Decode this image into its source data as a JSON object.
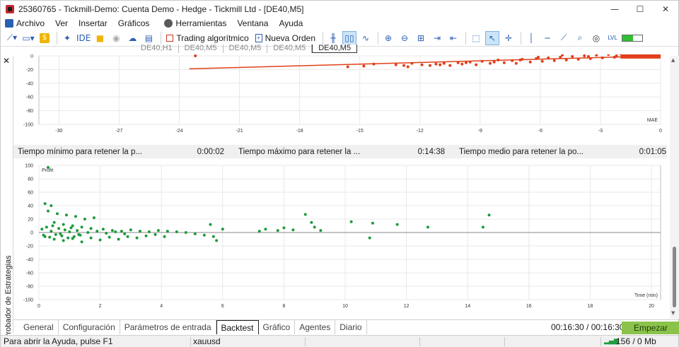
{
  "window": {
    "title": "25360765 - Tickmill-Demo: Cuenta Demo - Hedge - Tickmill Ltd - [DE40,M5]",
    "minimize": "—",
    "maximize": "☐",
    "close": "✕"
  },
  "menu": [
    "Archivo",
    "Ver",
    "Insertar",
    "Gráficos",
    "Herramientas",
    "Ventana",
    "Ayuda"
  ],
  "toolbar": {
    "ide_label": "IDE",
    "algo_label": "Trading algorítmico",
    "order_label": "Nueva Orden",
    "battery_label": "LVL",
    "battery_level": 0.55
  },
  "chart_tabs": [
    "DE40,H1",
    "DE40,M5",
    "DE40,M5",
    "DE40,M5",
    "DE40,M5"
  ],
  "mae_chart": {
    "type": "scatter",
    "xlabel": "MAE",
    "xlim": [
      -31,
      0
    ],
    "ylim": [
      -100,
      0
    ],
    "xticks": [
      -30,
      -27,
      -24,
      -21,
      -18,
      -15,
      -12,
      -9,
      -6,
      -3,
      0
    ],
    "yticks": [
      0,
      -20,
      -40,
      -60,
      -80,
      -100
    ],
    "color": "#e0401a",
    "trend": [
      [
        -23.5,
        -19
      ],
      [
        0,
        0
      ]
    ],
    "points": [
      [
        -23.2,
        0
      ],
      [
        -15.3,
        4
      ],
      [
        -15.6,
        -16
      ],
      [
        -14.8,
        -15
      ],
      [
        -14.3,
        -12
      ],
      [
        -13.2,
        -13
      ],
      [
        -12.8,
        -14
      ],
      [
        -12.4,
        -11
      ],
      [
        -12.6,
        -16
      ],
      [
        -11.9,
        -13
      ],
      [
        -11.5,
        -14
      ],
      [
        -11.2,
        -12
      ],
      [
        -10.8,
        -11
      ],
      [
        -10.5,
        -14
      ],
      [
        -10.1,
        -10
      ],
      [
        -9.9,
        -12
      ],
      [
        -9.5,
        -9
      ],
      [
        -9.2,
        -13
      ],
      [
        -8.9,
        -8
      ],
      [
        -8.5,
        -11
      ],
      [
        -8.1,
        -6
      ],
      [
        -7.8,
        -10
      ],
      [
        -7.4,
        -7
      ],
      [
        -7.2,
        -11
      ],
      [
        -6.9,
        -5
      ],
      [
        -6.5,
        -9
      ],
      [
        -6.2,
        -4
      ],
      [
        -5.9,
        -8
      ],
      [
        -5.6,
        -3
      ],
      [
        -5.3,
        -7
      ],
      [
        -5.0,
        -2
      ],
      [
        -4.7,
        -6
      ],
      [
        -4.4,
        -1
      ],
      [
        -4.1,
        -5
      ],
      [
        -3.8,
        0
      ],
      [
        -3.5,
        -4
      ],
      [
        -3.2,
        1
      ],
      [
        -2.9,
        -3
      ],
      [
        -2.6,
        2
      ],
      [
        -2.3,
        -2
      ],
      [
        -2.0,
        3
      ],
      [
        -1.7,
        -1
      ],
      [
        -1.4,
        4
      ],
      [
        -1.1,
        0
      ],
      [
        -0.8,
        5
      ],
      [
        -0.5,
        1
      ],
      [
        -0.2,
        6
      ],
      [
        -6.1,
        -2
      ],
      [
        -4.9,
        1
      ],
      [
        -3.6,
        -1
      ],
      [
        -2.2,
        0
      ],
      [
        -1.2,
        2
      ],
      [
        -0.6,
        3
      ],
      [
        -7.0,
        -6
      ],
      [
        -8.3,
        -9
      ],
      [
        -9.7,
        -10
      ],
      [
        -11.0,
        -13
      ]
    ],
    "dense_band": [
      -2.0,
      0
    ]
  },
  "stats": {
    "min_label": "Tiempo mínimo para retener la p...",
    "min_value": "0:00:02",
    "max_label": "Tiempo máximo para retener la ...",
    "max_value": "0:14:38",
    "avg_label": "Tiempo medio para retener la po...",
    "avg_value": "0:01:05"
  },
  "profit_chart": {
    "type": "scatter",
    "label": "Profit",
    "xlabel": "Time (min)",
    "xlim": [
      0,
      20.3
    ],
    "ylim": [
      -100,
      100
    ],
    "xticks": [
      0,
      2,
      4,
      6,
      8,
      10,
      12,
      14,
      16,
      18,
      20
    ],
    "yticks": [
      100,
      80,
      60,
      40,
      20,
      0,
      -20,
      -40,
      -60,
      -80,
      -100
    ],
    "color": "#1e9b3b",
    "points": [
      [
        0.3,
        97
      ],
      [
        0.2,
        43
      ],
      [
        0.4,
        40
      ],
      [
        0.3,
        32
      ],
      [
        0.6,
        28
      ],
      [
        0.9,
        26
      ],
      [
        1.2,
        24
      ],
      [
        1.5,
        20
      ],
      [
        1.8,
        22
      ],
      [
        0.5,
        15
      ],
      [
        0.8,
        12
      ],
      [
        1.1,
        10
      ],
      [
        1.4,
        8
      ],
      [
        1.7,
        6
      ],
      [
        2.1,
        5
      ],
      [
        2.4,
        3
      ],
      [
        2.7,
        2
      ],
      [
        3.0,
        4
      ],
      [
        3.3,
        2
      ],
      [
        3.6,
        1
      ],
      [
        3.9,
        3
      ],
      [
        4.2,
        2
      ],
      [
        4.5,
        1
      ],
      [
        4.8,
        0
      ],
      [
        5.1,
        -2
      ],
      [
        5.4,
        -4
      ],
      [
        5.7,
        -6
      ],
      [
        6.0,
        5
      ],
      [
        5.8,
        -12
      ],
      [
        5.6,
        12
      ],
      [
        7.2,
        2
      ],
      [
        7.4,
        5
      ],
      [
        7.8,
        3
      ],
      [
        8.0,
        7
      ],
      [
        8.3,
        4
      ],
      [
        8.7,
        27
      ],
      [
        8.9,
        15
      ],
      [
        9.0,
        8
      ],
      [
        9.2,
        3
      ],
      [
        10.2,
        16
      ],
      [
        10.8,
        -8
      ],
      [
        10.9,
        14
      ],
      [
        11.7,
        12
      ],
      [
        12.7,
        8
      ],
      [
        14.5,
        8
      ],
      [
        14.7,
        26
      ],
      [
        0.2,
        -6
      ],
      [
        0.5,
        -10
      ],
      [
        0.8,
        -12
      ],
      [
        1.1,
        -9
      ],
      [
        1.4,
        -14
      ],
      [
        1.7,
        -8
      ],
      [
        2.0,
        -11
      ],
      [
        2.3,
        -7
      ],
      [
        2.6,
        -10
      ],
      [
        2.9,
        -6
      ],
      [
        3.2,
        -8
      ],
      [
        3.5,
        -5
      ],
      [
        3.8,
        -3
      ],
      [
        4.1,
        -6
      ],
      [
        0.4,
        2
      ],
      [
        0.7,
        -2
      ],
      [
        1.0,
        1
      ],
      [
        1.3,
        -3
      ],
      [
        1.6,
        0
      ],
      [
        1.9,
        2
      ],
      [
        2.2,
        -1
      ],
      [
        2.5,
        1
      ],
      [
        2.8,
        -2
      ],
      [
        0.1,
        5
      ],
      [
        0.15,
        -4
      ],
      [
        0.25,
        8
      ],
      [
        0.35,
        -7
      ],
      [
        0.45,
        10
      ],
      [
        0.55,
        -3
      ],
      [
        0.65,
        6
      ],
      [
        0.75,
        -5
      ],
      [
        0.85,
        4
      ],
      [
        0.95,
        -8
      ],
      [
        1.05,
        7
      ],
      [
        1.15,
        -6
      ],
      [
        1.25,
        3
      ],
      [
        1.35,
        -4
      ]
    ]
  },
  "side_panel_label": "Probador de Estrategias",
  "bottom_tabs": [
    "General",
    "Configuración",
    "Parámetros de entrada",
    "Backtest",
    "Gráfico",
    "Agentes",
    "Diario"
  ],
  "active_tab": "Backtest",
  "test_time": "00:16:30 / 00:16:30",
  "start_button": "Empezar",
  "status": {
    "help": "Para abrir la Ayuda, pulse F1",
    "profile": "xauusd",
    "memory": "156 / 0 Mb"
  }
}
